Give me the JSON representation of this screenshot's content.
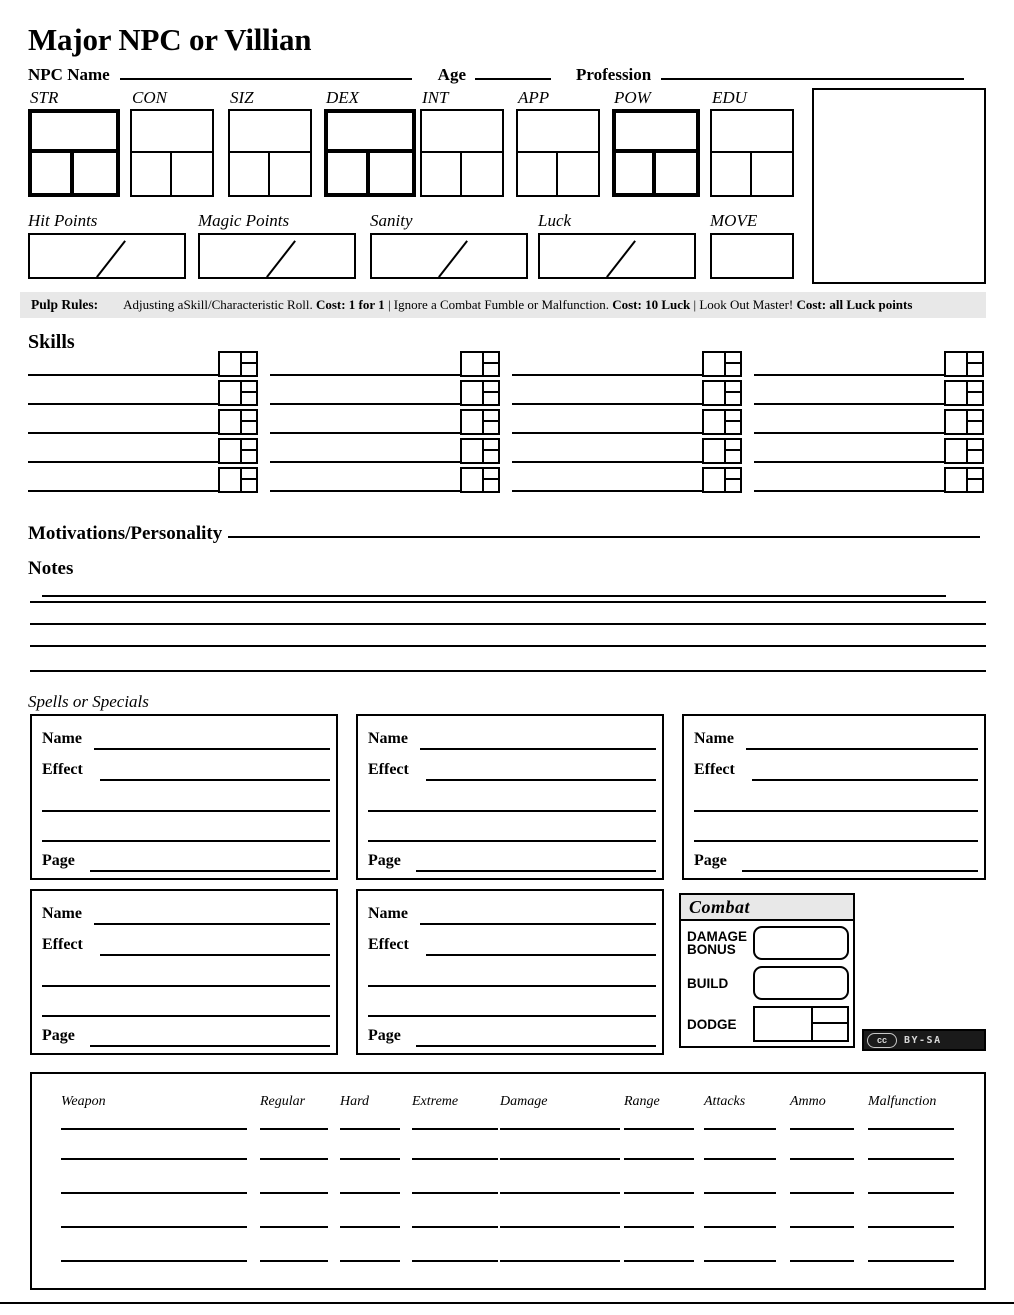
{
  "title": "Major NPC or Villian",
  "identity": {
    "name_label": "NPC Name",
    "age_label": "Age",
    "profession_label": "Profession"
  },
  "characteristics": [
    {
      "label": "STR",
      "emphasis": true
    },
    {
      "label": "CON",
      "emphasis": false
    },
    {
      "label": "SIZ",
      "emphasis": false
    },
    {
      "label": "DEX",
      "emphasis": true
    },
    {
      "label": "INT",
      "emphasis": false
    },
    {
      "label": "APP",
      "emphasis": false
    },
    {
      "label": "POW",
      "emphasis": true
    },
    {
      "label": "EDU",
      "emphasis": false
    }
  ],
  "derived": [
    {
      "label": "Hit Points",
      "has_slash": true
    },
    {
      "label": "Magic Points",
      "has_slash": true
    },
    {
      "label": "Sanity",
      "has_slash": true
    },
    {
      "label": "Luck",
      "has_slash": true
    },
    {
      "label": "MOVE",
      "has_slash": false
    }
  ],
  "pulp_rules": {
    "title": "Pulp Rules:",
    "segments": [
      {
        "text": "Adjusting aSkill/Characteristic Roll. ",
        "bold": false
      },
      {
        "text": "Cost: 1 for 1",
        "bold": true
      },
      {
        "text": " | Ignore a Combat Fumble or Malfunction. ",
        "bold": false
      },
      {
        "text": "Cost: 10 Luck",
        "bold": true
      },
      {
        "text": " | Look Out Master! ",
        "bold": false
      },
      {
        "text": "Cost: all Luck points",
        "bold": true
      }
    ]
  },
  "skills": {
    "heading": "Skills",
    "columns": 4,
    "rows": 5
  },
  "motivations": {
    "label": "Motivations/Personality"
  },
  "notes": {
    "label": "Notes",
    "extra_lines": 4
  },
  "spells": {
    "heading": "Spells or Specials",
    "field_labels": {
      "name": "Name",
      "effect": "Effect",
      "page": "Page"
    },
    "boxes": [
      {
        "name": "Name",
        "effect": "Effect",
        "page": "Page"
      },
      {
        "name": "Name",
        "effect": "Effect",
        "page": "Page"
      },
      {
        "name": "Name",
        "effect": "Effect",
        "page": "Page"
      },
      {
        "name": "Name",
        "effect": "Effect",
        "page": "Page"
      },
      {
        "name": "Name",
        "effect": "Effect",
        "page": "Page"
      }
    ]
  },
  "combat": {
    "heading": "Combat",
    "rows": [
      {
        "label_line1": "DAMAGE",
        "label_line2": "BONUS",
        "type": "rounded"
      },
      {
        "label_line1": "BUILD",
        "label_line2": "",
        "type": "rounded"
      },
      {
        "label_line1": "DODGE",
        "label_line2": "",
        "type": "split"
      }
    ]
  },
  "license": {
    "mark": "cc",
    "terms": "BY-SA"
  },
  "weapons": {
    "headers": [
      "Weapon",
      "Regular",
      "Hard",
      "Extreme",
      "Damage",
      "Range",
      "Attacks",
      "Ammo",
      "Malfunction"
    ],
    "rows": 5
  },
  "colors": {
    "ink": "#000000",
    "band": "#e8e8e8",
    "paper": "#ffffff",
    "badge": "#1a1a1a"
  }
}
